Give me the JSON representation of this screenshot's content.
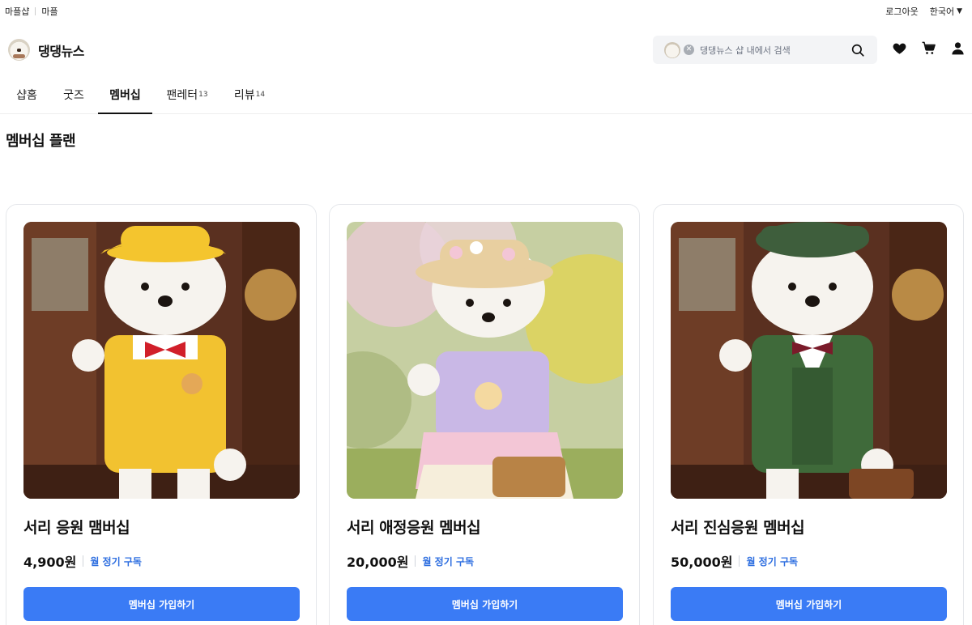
{
  "topbar": {
    "links": [
      "마플샵",
      "마플"
    ],
    "logout": "로그아웃",
    "language": "한국어"
  },
  "header": {
    "brand": "댕댕뉴스",
    "search_placeholder": "댕댕뉴스 샵 내에서 검색"
  },
  "tabs": [
    {
      "label": "샵홈",
      "count": ""
    },
    {
      "label": "굿즈",
      "count": ""
    },
    {
      "label": "멤버십",
      "count": "",
      "active": true
    },
    {
      "label": "팬레터",
      "count": "13"
    },
    {
      "label": "리뷰",
      "count": "14"
    }
  ],
  "section": {
    "title": "멤버십 플랜"
  },
  "plans": [
    {
      "name": "서리 응원 맴버십",
      "price": "4,900원",
      "period": "월 정기 구독",
      "button": "멤버십 가입하기",
      "outfit_color": "#f2c230",
      "hat_color": "#f4c52e",
      "bg_color": "#5a3020"
    },
    {
      "name": "서리 애정응원 멤버십",
      "price": "20,000원",
      "period": "월 정기 구독",
      "button": "멤버십 가입하기",
      "outfit_color": "#c9b8e6",
      "hat_color": "#e8cfa0",
      "bg_color": "#c6cfa2"
    },
    {
      "name": "서리 진심응원 멤버십",
      "price": "50,000원",
      "period": "월 정기 구독",
      "button": "멤버십 가입하기",
      "outfit_color": "#3f6a3a",
      "hat_color": "#3e5e3c",
      "bg_color": "#5a3020"
    }
  ],
  "colors": {
    "accent": "#3a7bf5",
    "link": "#2f6fe0"
  }
}
